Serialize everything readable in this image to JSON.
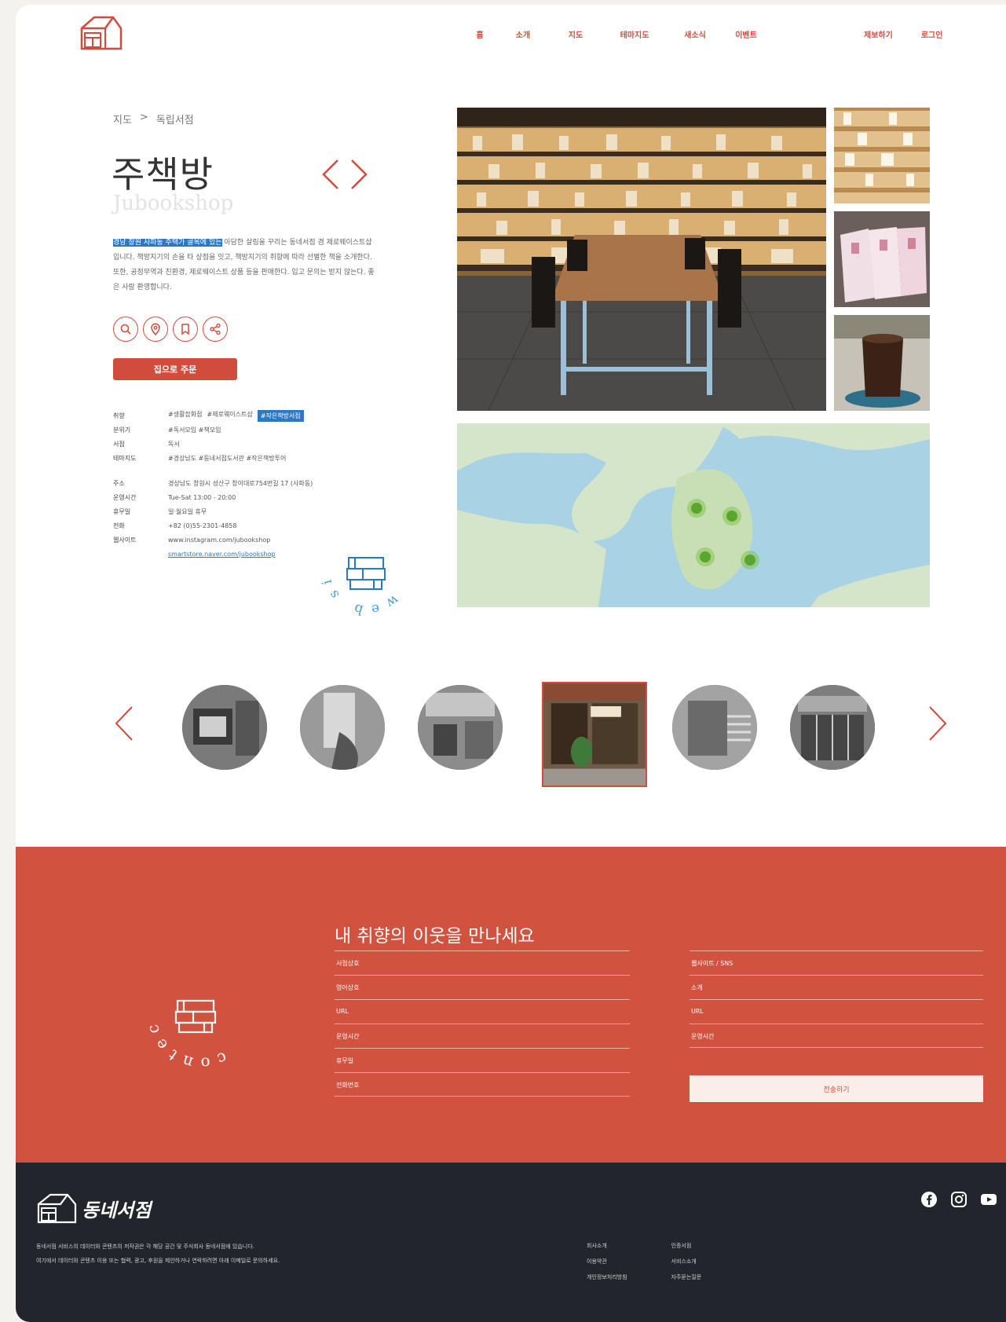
{
  "header": {
    "nav": [
      "홈",
      "소개",
      "지도",
      "테마지도",
      "새소식",
      "이벤트"
    ],
    "auth": [
      "제보하기",
      "로그인"
    ]
  },
  "breadcrumb": [
    "지도",
    ">",
    "독립서점"
  ],
  "shop": {
    "name": "주책방",
    "name_en": "Jubookshop",
    "desc_highlight": "경남 창원 사파동 주택가 골목에 있는",
    "desc_rest": " 아담한 살림을 꾸리는 동네서점 겸 제로웨이스트샵입니다. 책방지기의 손을 타 상점을 잇고, 책방지기의 취향에 따라 선별한 책을 소개한다. 또한, 공정무역과 친환경, 제로웨이스트 상품 등을 판매한다. 입고 문의는 받지 않는다. 좋은 사람 환영합니다.",
    "order_label": "집으로 주문"
  },
  "info": {
    "keys": [
      "취향",
      "분위기",
      "서점",
      "테마지도",
      "주소",
      "운영시간",
      "휴무일",
      "전화",
      "웹사이트"
    ],
    "taste_tags": [
      "#생활잡화점",
      "#제로웨이스트샵"
    ],
    "taste_tag_highlight": "#작은책방서점",
    "mood": "#독서모임 #책모임",
    "store": "독서",
    "theme": "#경상남도 #동네서점도서관 #작은책방투어",
    "address": "경상남도 창원시 성산구 창이대로754번길 17 (사파동)",
    "hours": "Tue-Sat 13:00 - 20:00",
    "closed": "일·월요일 휴무",
    "phone": "+82 (0)55-2301-4858",
    "site1": "www.instagram.com/jubookshop",
    "site2": "smartstore.naver.com/jubookshop"
  },
  "website_badge": "web site go",
  "contact": {
    "heading": "내 취향의 이웃을 만나세요",
    "left_fields": [
      "서점상호",
      "영어상호",
      "URL",
      "운영시간",
      "휴무일",
      "전화번호"
    ],
    "right_fields": [
      "웹사이트 / SNS",
      "소개",
      "URL",
      "운영시간"
    ],
    "submit_label": "전송하기",
    "badge": "contect-us"
  },
  "footer": {
    "brand": "동네서점",
    "desc_line1": "동네서점 서비스의 데이터와 콘텐츠의 저작권은 각 해당 공간 및 주식회사 동네서점에 있습니다.",
    "desc_line2": "여기에서 데이터와 콘텐츠 이용 또는 협력, 광고, 후원을 제안하거나 연락하려면 아래 이메일로 문의하세요.",
    "links_col1": [
      "회사소개",
      "이용약관",
      "개인정보처리방침"
    ],
    "links_col2": [
      "인증서점",
      "서비스소개",
      "자주묻는질문"
    ],
    "social": [
      "facebook-icon",
      "instagram-icon",
      "youtube-icon"
    ]
  },
  "colors": {
    "accent": "#d14c3c",
    "contact_bg": "#d25240",
    "footer_bg": "#23252c",
    "highlight": "#2b78c5"
  }
}
